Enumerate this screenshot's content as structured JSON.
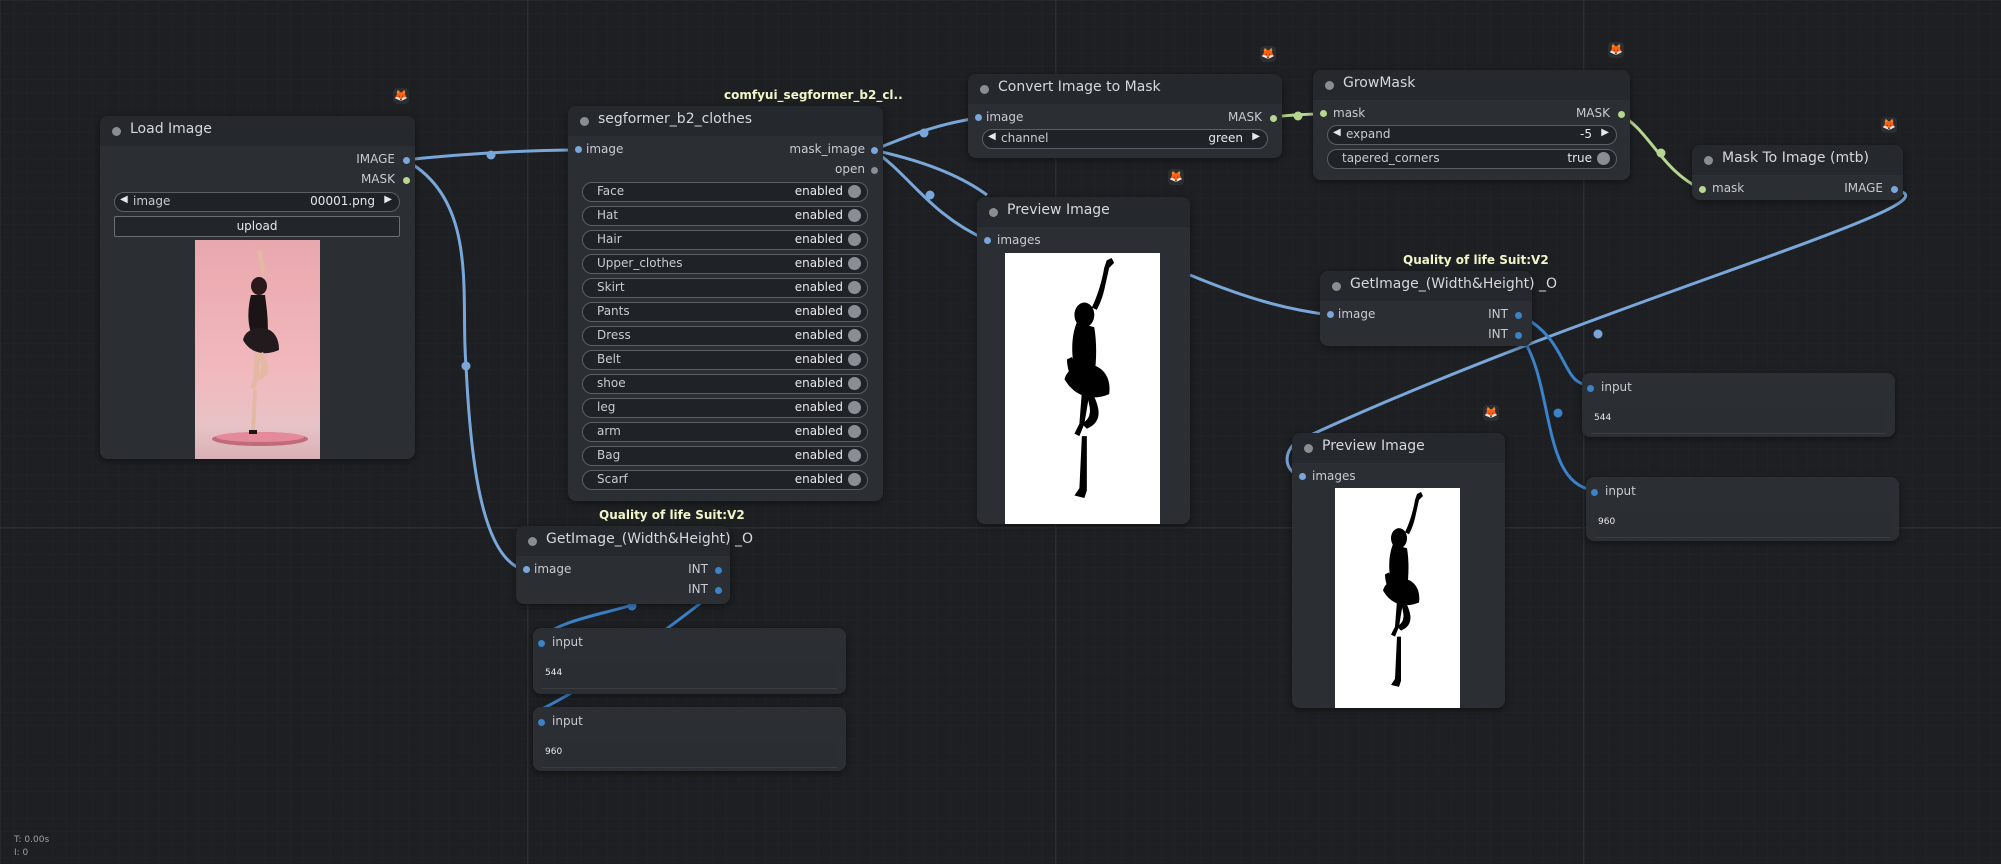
{
  "colors": {
    "image_wire": "#7aa7d9",
    "mask_wire": "#b7d68f",
    "int_wire": "#3b82c8"
  },
  "load_image": {
    "title": "Load Image",
    "out_image": "IMAGE",
    "out_mask": "MASK",
    "widget_label": "image",
    "widget_value": "00001.png",
    "upload_label": "upload",
    "preview": "photo of woman posing in black dress on pink background"
  },
  "segformer": {
    "group_label": "comfyui_segformer_b2_cl..",
    "title": "segformer_b2_clothes",
    "in_image": "image",
    "out_mask_image": "mask_image",
    "out_open": "open",
    "options": [
      {
        "label": "Face",
        "value": "enabled"
      },
      {
        "label": "Hat",
        "value": "enabled"
      },
      {
        "label": "Hair",
        "value": "enabled"
      },
      {
        "label": "Upper_clothes",
        "value": "enabled"
      },
      {
        "label": "Skirt",
        "value": "enabled"
      },
      {
        "label": "Pants",
        "value": "enabled"
      },
      {
        "label": "Dress",
        "value": "enabled"
      },
      {
        "label": "Belt",
        "value": "enabled"
      },
      {
        "label": "shoe",
        "value": "enabled"
      },
      {
        "label": "leg",
        "value": "enabled"
      },
      {
        "label": "arm",
        "value": "enabled"
      },
      {
        "label": "Bag",
        "value": "enabled"
      },
      {
        "label": "Scarf",
        "value": "enabled"
      }
    ]
  },
  "convert": {
    "title": "Convert Image to Mask",
    "in_image": "image",
    "out_mask": "MASK",
    "widget_label": "channel",
    "widget_value": "green"
  },
  "growmask": {
    "title": "GrowMask",
    "in_mask": "mask",
    "out_mask": "MASK",
    "expand_label": "expand",
    "expand_value": "-5",
    "tapered_label": "tapered_corners",
    "tapered_value": "true"
  },
  "mask_to_image": {
    "title": "Mask To Image (mtb)",
    "in_mask": "mask",
    "out_image": "IMAGE"
  },
  "preview1": {
    "title": "Preview Image",
    "in_images": "images"
  },
  "preview2": {
    "title": "Preview Image",
    "in_images": "images"
  },
  "getimage1": {
    "group_label": "Quality of life Suit:V2",
    "title": "GetImage_(Width&Height) _O",
    "in_image": "image",
    "out1": "INT",
    "out2": "INT"
  },
  "getimage2": {
    "group_label": "Quality of life Suit:V2",
    "title": "GetImage_(Width&Height) _O",
    "in_image": "image",
    "out1": "INT",
    "out2": "INT"
  },
  "inputs": [
    {
      "label": "input",
      "value": "544"
    },
    {
      "label": "input",
      "value": "960"
    },
    {
      "label": "input",
      "value": "544"
    },
    {
      "label": "input",
      "value": "960"
    }
  ],
  "stats": {
    "time": "T: 0.00s",
    "frames": "I: 0"
  }
}
